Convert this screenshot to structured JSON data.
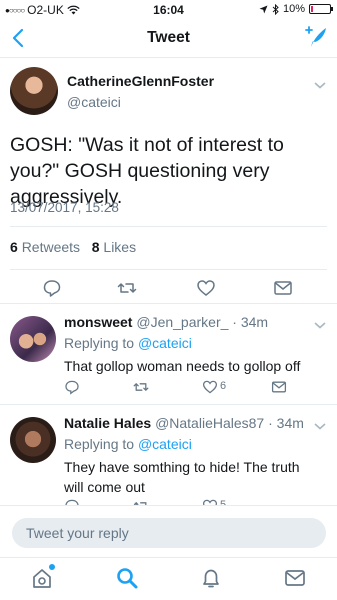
{
  "status_bar": {
    "carrier": "O2-UK",
    "time": "16:04",
    "battery": "10%",
    "battery_level": 0.1,
    "battery_color": "#e0245e"
  },
  "nav": {
    "title": "Tweet",
    "back_icon": "chevron-left-icon",
    "compose_icon": "compose-tweet-icon"
  },
  "tweet": {
    "author_name": "CatherineGlennFoster",
    "author_handle": "@cateici",
    "text": "GOSH: \"Was it not of interest to you?\" GOSH questioning very aggressively.",
    "timestamp": "13/07/2017, 15:28",
    "retweets_count": "6",
    "retweets_label": "Retweets",
    "likes_count": "8",
    "likes_label": "Likes"
  },
  "replies": [
    {
      "name": "monsweet",
      "handle": "@Jen_parker_",
      "age": "34m",
      "replying_prefix": "Replying to",
      "replying_to": "@cateici",
      "text": "That gollop woman needs to gollop off",
      "like_count": "6"
    },
    {
      "name": "Natalie Hales",
      "handle": "@NatalieHales87",
      "age": "34m",
      "replying_prefix": "Replying to",
      "replying_to": "@cateici",
      "text": "They have somthing to hide! The truth will come out",
      "like_count": "5"
    }
  ],
  "compose": {
    "placeholder": "Tweet your reply"
  },
  "tabs": [
    "home-icon",
    "search-icon",
    "notifications-icon",
    "messages-icon"
  ],
  "colors": {
    "accent": "#1da1f2",
    "secondary_text": "#657786",
    "divider": "#e6ecf0"
  }
}
